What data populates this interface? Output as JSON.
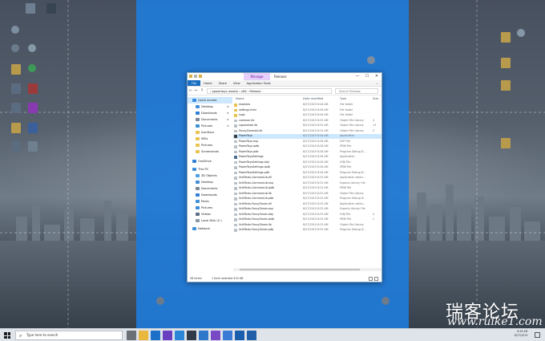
{
  "window": {
    "title": "Release",
    "manage_tab": "Manage",
    "controls": {
      "minimize": "—",
      "maximize": "☐",
      "close": "✕"
    }
  },
  "ribbon": {
    "tabs": [
      "File",
      "Home",
      "Share",
      "View",
      "Application Tools"
    ]
  },
  "address": {
    "path": "›  powertoys-master  ›  x64  ›  Release",
    "search_placeholder": "Search Release"
  },
  "nav": {
    "items": [
      {
        "label": "Quick access",
        "color": "#3a8be0"
      },
      {
        "label": "Desktop",
        "color": "#3f8ed8",
        "pinned": true
      },
      {
        "label": "Downloads",
        "color": "#2f7fd6",
        "pinned": true
      },
      {
        "label": "Documents",
        "color": "#7b8797",
        "pinned": true
      },
      {
        "label": "Pictures",
        "color": "#3a8fd3",
        "pinned": true
      },
      {
        "label": "IconDocs",
        "color": "#e9c24f"
      },
      {
        "label": "MSIs",
        "color": "#e9c24f"
      },
      {
        "label": "Pictures",
        "color": "#e9c24f"
      },
      {
        "label": "Screenshots",
        "color": "#e9c24f"
      },
      {
        "label": "OneDrive",
        "color": "#2f7fd6"
      },
      {
        "label": "This PC",
        "color": "#3f8ed8"
      },
      {
        "label": "3D Objects",
        "color": "#4ea0e0"
      },
      {
        "label": "Desktop",
        "color": "#3f8ed8"
      },
      {
        "label": "Documents",
        "color": "#7b8797"
      },
      {
        "label": "Downloads",
        "color": "#2f7fd6"
      },
      {
        "label": "Music",
        "color": "#3f8ed8"
      },
      {
        "label": "Pictures",
        "color": "#3a8fd3"
      },
      {
        "label": "Videos",
        "color": "#5a6d85"
      },
      {
        "label": "Local Disk (C:)",
        "color": "#8a96a5"
      },
      {
        "label": "Network",
        "color": "#3f8ed8"
      }
    ]
  },
  "files": {
    "columns": {
      "name": "Name",
      "date": "Date modified",
      "type": "Type",
      "size": "Size"
    },
    "rows": [
      {
        "name": "modules",
        "date": "8/27/2019 8:26 AM",
        "type": "File folder",
        "size": "",
        "color": "#e9c24f"
      },
      {
        "name": "settings-html",
        "date": "8/27/2019 8:26 AM",
        "type": "File folder",
        "size": "",
        "color": "#e9c24f"
      },
      {
        "name": "svgs",
        "date": "8/27/2019 8:26 AM",
        "type": "File folder",
        "size": "",
        "color": "#e9c24f"
      },
      {
        "name": "common.lib",
        "date": "8/27/2019 8:25 AM",
        "type": "Object File Library",
        "size": "4",
        "color": "#b9c0c8"
      },
      {
        "name": "cpprestsdk.lib",
        "date": "8/27/2019 8:25 AM",
        "type": "Object File Library",
        "size": "13",
        "color": "#b9c0c8"
      },
      {
        "name": "FancyZonesLib.lib",
        "date": "8/27/2019 8:25 AM",
        "type": "Object File Library",
        "size": "2",
        "color": "#b9c0c8"
      },
      {
        "name": "PowerToys",
        "date": "8/27/2019 8:26 AM",
        "type": "Application",
        "size": "",
        "color": "#3c3c3c"
      },
      {
        "name": "PowerToys.exp",
        "date": "8/27/2019 8:26 AM",
        "type": "EXP File",
        "size": "",
        "color": "#b9c0c8"
      },
      {
        "name": "PowerToys.ipdb",
        "date": "8/27/2019 8:26 AM",
        "type": "IPDB File",
        "size": "",
        "color": "#b9c0c8"
      },
      {
        "name": "PowerToys.pdb",
        "date": "8/27/2019 8:26 AM",
        "type": "Program Debug D...",
        "size": "",
        "color": "#b9c0c8"
      },
      {
        "name": "PowerToysSettings",
        "date": "8/27/2019 8:26 AM",
        "type": "Application",
        "size": "",
        "color": "#4a6c8f"
      },
      {
        "name": "PowerToysSettings.iobj",
        "date": "8/27/2019 8:26 AM",
        "type": "IOBJ File",
        "size": "",
        "color": "#b9c0c8"
      },
      {
        "name": "PowerToysSettings.ipdb",
        "date": "8/27/2019 8:26 AM",
        "type": "IPDB File",
        "size": "",
        "color": "#b9c0c8"
      },
      {
        "name": "PowerToysSettings.pdb",
        "date": "8/27/2019 8:26 AM",
        "type": "Program Debug D...",
        "size": "",
        "color": "#b9c0c8"
      },
      {
        "name": "UnitTests-CommonLib.dll",
        "date": "8/27/2019 8:25 AM",
        "type": "Application exten...",
        "size": "",
        "color": "#b9c0c8"
      },
      {
        "name": "UnitTests-CommonLib.exp",
        "date": "8/27/2019 8:25 AM",
        "type": "Exports Library File",
        "size": "",
        "color": "#b9c0c8"
      },
      {
        "name": "UnitTests-CommonLib.ipdb",
        "date": "8/27/2019 8:25 AM",
        "type": "IPDB File",
        "size": "",
        "color": "#b9c0c8"
      },
      {
        "name": "UnitTests-CommonLib.lib",
        "date": "8/27/2019 8:25 AM",
        "type": "Object File Library",
        "size": "",
        "color": "#b9c0c8"
      },
      {
        "name": "UnitTests-CommonLib.pdb",
        "date": "8/27/2019 8:25 AM",
        "type": "Program Debug D...",
        "size": "",
        "color": "#b9c0c8"
      },
      {
        "name": "UnitTests-FancyZones.dll",
        "date": "8/27/2019 8:25 AM",
        "type": "Application exten...",
        "size": "",
        "color": "#b9c0c8"
      },
      {
        "name": "UnitTests-FancyZones.exp",
        "date": "8/27/2019 8:25 AM",
        "type": "Exports Library File",
        "size": "",
        "color": "#b9c0c8"
      },
      {
        "name": "UnitTests-FancyZones.iobj",
        "date": "8/27/2019 8:25 AM",
        "type": "IOBJ File",
        "size": "4",
        "color": "#b9c0c8"
      },
      {
        "name": "UnitTests-FancyZones.ipdb",
        "date": "8/27/2019 8:25 AM",
        "type": "IPDB File",
        "size": "1",
        "color": "#b9c0c8"
      },
      {
        "name": "UnitTests-FancyZones.lib",
        "date": "8/27/2019 8:25 AM",
        "type": "Object File Library",
        "size": "",
        "color": "#b9c0c8"
      },
      {
        "name": "UnitTests-FancyZones.pdb",
        "date": "8/27/2019 8:25 AM",
        "type": "Program Debug D...",
        "size": "",
        "color": "#b9c0c8"
      }
    ]
  },
  "status": {
    "count": "26 items",
    "selected": "1 item selected  410 KB"
  },
  "taskbar": {
    "search_placeholder": "Type here to search",
    "apps": [
      {
        "icon": "task-view-icon",
        "color": "#6b6f76"
      },
      {
        "icon": "file-explorer-icon",
        "color": "#e8b73c"
      },
      {
        "icon": "edge-icon",
        "color": "#1d70c8"
      },
      {
        "icon": "visual-studio-icon",
        "color": "#6a3fbf"
      },
      {
        "icon": "vs-code-icon",
        "color": "#2b86d8"
      },
      {
        "icon": "terminal-icon",
        "color": "#303a48"
      },
      {
        "icon": "mail-icon",
        "color": "#2f77c9"
      },
      {
        "icon": "visual-studio-2-icon",
        "color": "#7a4ac6"
      },
      {
        "icon": "store-icon",
        "color": "#3a7bd5"
      },
      {
        "icon": "app-icon",
        "color": "#1a5fae"
      },
      {
        "icon": "app-2-icon",
        "color": "#2160a8"
      }
    ],
    "clock_time": "8:26 AM",
    "clock_date": "8/27/2019"
  },
  "watermark": {
    "text": "瑞客论坛",
    "url": "www.ruike1.com"
  }
}
